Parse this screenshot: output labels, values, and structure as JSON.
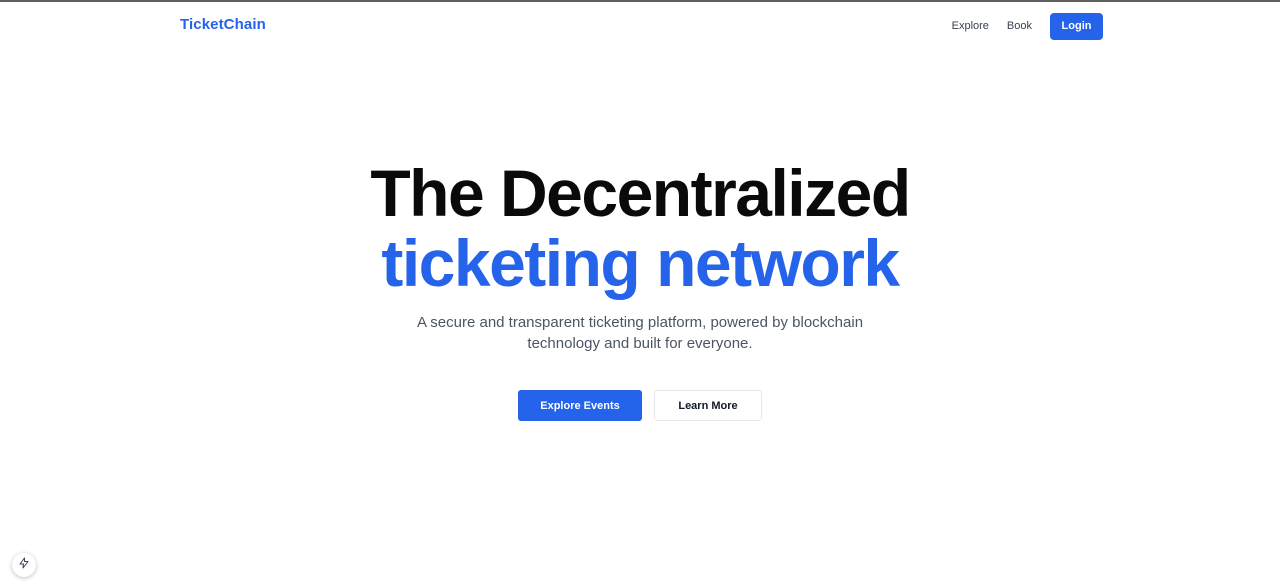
{
  "navbar": {
    "brand": "TicketChain",
    "links": [
      {
        "label": "Explore"
      },
      {
        "label": "Book"
      }
    ],
    "login_label": "Login"
  },
  "hero": {
    "title_line1": "The Decentralized",
    "title_line2": "ticketing network",
    "subtitle": "A secure and transparent ticketing platform, powered by blockchain technology and built for everyone.",
    "primary_cta": "Explore Events",
    "secondary_cta": "Learn More"
  },
  "icons": {
    "dev_indicator": "lightning-bolt-icon"
  },
  "colors": {
    "accent": "#2563eb",
    "heading": "#0a0a0a",
    "body_text": "#4b5563"
  }
}
